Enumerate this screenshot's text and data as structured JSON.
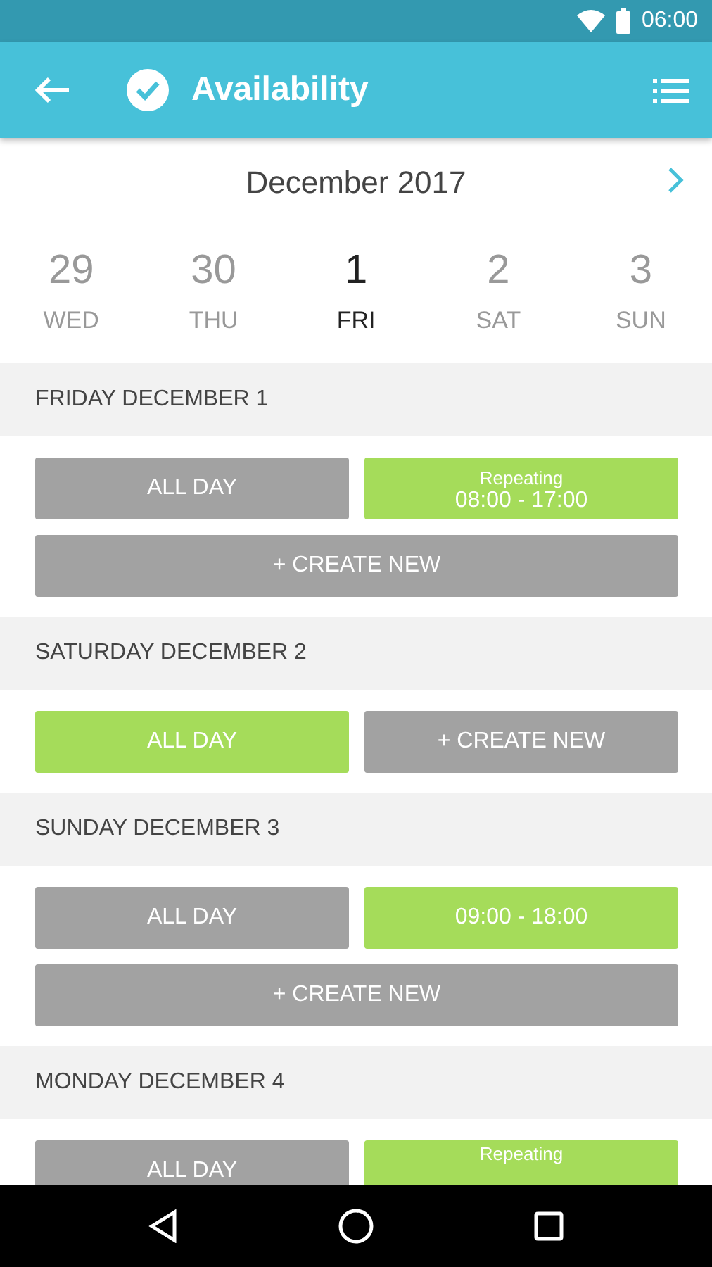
{
  "status_bar": {
    "time": "06:00"
  },
  "app_bar": {
    "title": "Availability"
  },
  "month": {
    "title": "December 2017"
  },
  "days": [
    {
      "number": "29",
      "weekday": "WED",
      "selected": false
    },
    {
      "number": "30",
      "weekday": "THU",
      "selected": false
    },
    {
      "number": "1",
      "weekday": "FRI",
      "selected": true
    },
    {
      "number": "2",
      "weekday": "SAT",
      "selected": false
    },
    {
      "number": "3",
      "weekday": "SUN",
      "selected": false
    }
  ],
  "sections": [
    {
      "title": "FRIDAY DECEMBER 1",
      "slots": [
        {
          "kind": "slot",
          "label": "ALL DAY",
          "available": false
        },
        {
          "kind": "slot",
          "note": "Repeating",
          "label": "08:00 - 17:00",
          "available": true
        },
        {
          "kind": "create",
          "label": "+ CREATE NEW",
          "available": false
        }
      ]
    },
    {
      "title": "SATURDAY DECEMBER 2",
      "slots": [
        {
          "kind": "slot",
          "label": "ALL DAY",
          "available": true
        },
        {
          "kind": "create",
          "label": "+ CREATE NEW",
          "available": false
        }
      ]
    },
    {
      "title": "SUNDAY DECEMBER 3",
      "slots": [
        {
          "kind": "slot",
          "label": "ALL DAY",
          "available": false
        },
        {
          "kind": "slot",
          "label": "09:00 - 18:00",
          "available": true
        },
        {
          "kind": "create",
          "label": "+ CREATE NEW",
          "available": false
        }
      ]
    },
    {
      "title": "MONDAY DECEMBER 4",
      "slots": [
        {
          "kind": "slot",
          "label": "ALL DAY",
          "available": false
        },
        {
          "kind": "slot",
          "note": "Repeating",
          "available": true
        }
      ]
    }
  ]
}
